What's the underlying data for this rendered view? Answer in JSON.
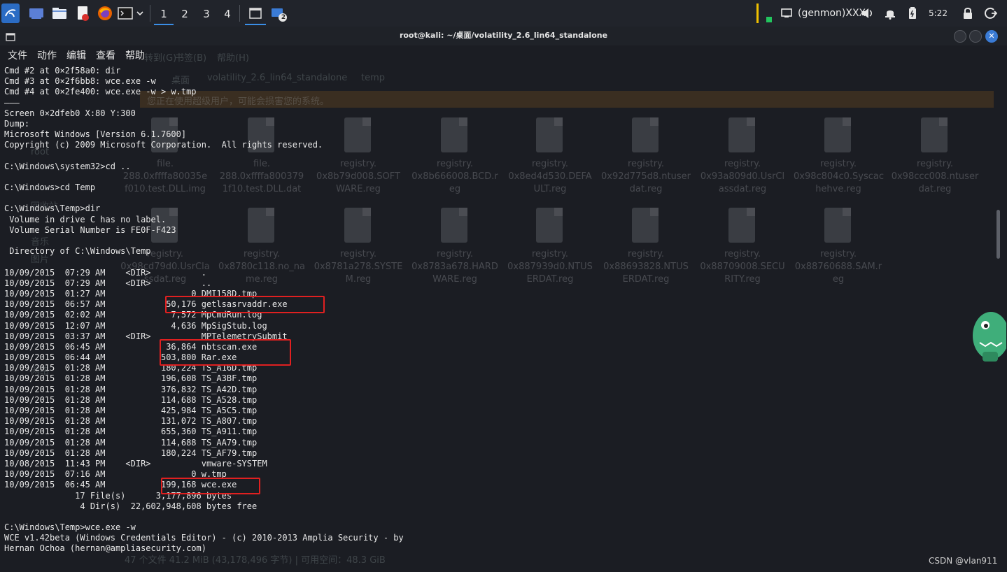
{
  "panel": {
    "workspaces": [
      "1",
      "2",
      "3",
      "4"
    ],
    "notification_badge": "2",
    "genmon_label": "(genmon)XXX",
    "clock": "5:22",
    "colors": {
      "accent": "#3a8ee6",
      "firefox": "#e66000"
    }
  },
  "window": {
    "title": "root@kali: ~/桌面/volatility_2.6_lin64_standalone"
  },
  "menu": [
    "文件",
    "动作",
    "编辑",
    "查看",
    "帮助"
  ],
  "background": {
    "ghost_menu": [
      "转到(G)",
      "书签(B)",
      "帮助(H)"
    ],
    "tabs": [
      "桌面",
      "volatility_2.6_lin64_standalone",
      "temp"
    ],
    "warning": "您正在使用超级用户，可能会损害您的系统。",
    "side_items": [
      "root",
      "回收站",
      "音乐",
      "图片",
      "网络"
    ],
    "files_row1": [
      "file.\n288.0xffffa80035e\nf010.test.DLL.img",
      "file.\n288.0xffffa800379\n1f10.test.DLL.dat",
      "registry.\n0x8b79d008.SOFT\nWARE.reg",
      "registry.\n0x8b666008.BCD.r\neg",
      "registry.\n0x8ed4d530.DEFA\nULT.reg",
      "registry.\n0x92d775d8.ntuser\ndat.reg",
      "registry.\n0x93a809d0.UsrCl\nassdat.reg",
      "registry.\n0x98c804c0.Syscac\nhehve.reg",
      "registry.\n0x98ccc008.ntuser\ndat.reg"
    ],
    "files_row2": [
      "registry.\n0x98cd79d0.UsrCla\nssdat.reg",
      "registry.\n0x8780c118.no_na\nme.reg",
      "registry.\n0x8781a278.SYSTE\nM.reg",
      "registry.\n0x8783a678.HARD\nWARE.reg",
      "registry.\n0x887939d0.NTUS\nERDAT.reg",
      "registry.\n0x88693828.NTUS\nERDAT.reg",
      "registry.\n0x88709008.SECU\nRITY.reg",
      "registry.\n0x88760688.SAM.r\neg"
    ],
    "status": "47 个文件 41.2 MiB (43,178,496 字节) | 可用空间：48.3 GiB"
  },
  "terminal": {
    "lines": [
      "Cmd #2 at 0×2f58a0: dir",
      "Cmd #3 at 0×2f6bb8: wce.exe -w",
      "Cmd #4 at 0×2fe400: wce.exe -w > w.tmp",
      "———",
      "Screen 0×2dfeb0 X:80 Y:300",
      "Dump:",
      "Microsoft Windows [Version 6.1.7600]",
      "Copyright (c) 2009 Microsoft Corporation.  All rights reserved.",
      "",
      "C:\\Windows\\system32>cd ..",
      "",
      "C:\\Windows>cd Temp",
      "",
      "C:\\Windows\\Temp>dir",
      " Volume in drive C has no label.",
      " Volume Serial Number is FE0F-F423",
      "",
      " Directory of C:\\Windows\\Temp",
      "",
      "10/09/2015  07:29 AM    <DIR>          .",
      "10/09/2015  07:29 AM    <DIR>          ..",
      "10/09/2015  01:27 AM                 0 DMI158D.tmp",
      "10/09/2015  06:57 AM            50,176 getlsasrvaddr.exe",
      "10/09/2015  02:02 AM             7,572 MpCmdRun.log",
      "10/09/2015  12:07 AM             4,636 MpSigStub.log",
      "10/09/2015  03:37 AM    <DIR>          MPTelemetrySubmit",
      "10/09/2015  06:45 AM            36,864 nbtscan.exe",
      "10/09/2015  06:44 AM           503,800 Rar.exe",
      "10/09/2015  01:28 AM           180,224 TS_A16D.tmp",
      "10/09/2015  01:28 AM           196,608 TS_A3BF.tmp",
      "10/09/2015  01:28 AM           376,832 TS_A42D.tmp",
      "10/09/2015  01:28 AM           114,688 TS_A528.tmp",
      "10/09/2015  01:28 AM           425,984 TS_A5C5.tmp",
      "10/09/2015  01:28 AM           131,072 TS_A807.tmp",
      "10/09/2015  01:28 AM           655,360 TS_A911.tmp",
      "10/09/2015  01:28 AM           114,688 TS_AA79.tmp",
      "10/09/2015  01:28 AM           180,224 TS_AF79.tmp",
      "10/08/2015  11:43 PM    <DIR>          vmware-SYSTEM",
      "10/09/2015  07:16 AM                 0 w.tmp",
      "10/09/2015  06:45 AM           199,168 wce.exe",
      "              17 File(s)      3,177,896 bytes",
      "               4 Dir(s)  22,602,948,608 bytes free",
      "",
      "C:\\Windows\\Temp>wce.exe -w",
      "WCE v1.42beta (Windows Credentials Editor) - (c) 2010-2013 Amplia Security - by",
      "Hernan Ochoa (hernan@ampliasecurity.com)"
    ]
  },
  "watermark": "CSDN @vlan911"
}
